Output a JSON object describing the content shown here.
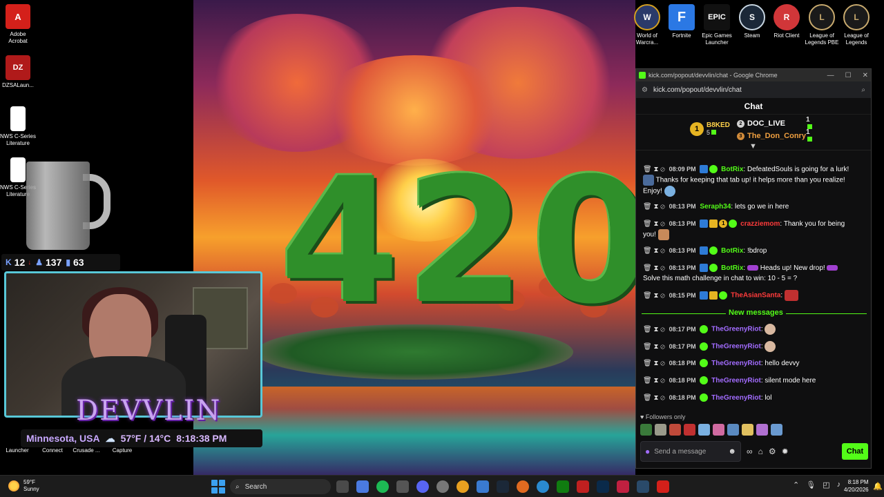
{
  "desktop_left": {
    "icons": [
      {
        "label": "Adobe Acrobat"
      },
      {
        "label": "DZSALaun..."
      },
      {
        "label": "NWS C-Series Literature"
      },
      {
        "label": "NWS C-Series Literature"
      }
    ],
    "bottom_labels": [
      "Launcher",
      "Connect",
      "Crusade ...",
      "Capture"
    ]
  },
  "desktop_right": {
    "icons": [
      {
        "label": "World of Warcra...",
        "color": "#2a3a6a",
        "glyph": "W"
      },
      {
        "label": "Fortnite",
        "color": "#2b78e4",
        "glyph": "F"
      },
      {
        "label": "Epic Games Launcher",
        "color": "#111111",
        "glyph": "EPIC"
      },
      {
        "label": "Steam",
        "color": "#1b2838",
        "glyph": "S"
      },
      {
        "label": "Riot Client",
        "color": "#d13639",
        "glyph": "R"
      },
      {
        "label": "League of Legends PBE",
        "color": "#1a1a1a",
        "glyph": "L"
      },
      {
        "label": "League of Legends",
        "color": "#1a1a1a",
        "glyph": "L"
      }
    ]
  },
  "wallpaper": {
    "text": "420"
  },
  "stream_overlay": {
    "stats": [
      {
        "icon": "kick-k-icon",
        "value": "12"
      },
      {
        "icon": "person-icon",
        "value": "137"
      },
      {
        "icon": "bars-icon",
        "value": "63"
      }
    ],
    "logo": "DEVVLIN",
    "location": "Minnesota, USA",
    "weather": "57°F / 14°C",
    "time": "8:18:38 PM"
  },
  "browser": {
    "title": "kick.com/popout/devvlin/chat - Google Chrome",
    "url": "kick.com/popout/devvlin/chat"
  },
  "chat": {
    "header": "Chat",
    "leaderboard": {
      "first": {
        "name": "B8KED",
        "count": "5"
      },
      "second": {
        "name": "DOC_LIVE",
        "count": "1"
      },
      "third": {
        "name": "The_Don_Conry",
        "count": "1"
      }
    },
    "messages": [
      {
        "time": "08:09 PM",
        "user": "BotRix",
        "text": "DefeatedSouls is going for a lurk!",
        "cont": "Thanks for keeping that tab up! it helps more than you realize! Enjoy!"
      },
      {
        "time": "08:13 PM",
        "user": "Seraph34",
        "text": "lets go we in here"
      },
      {
        "time": "08:13 PM",
        "user": "crazziemom",
        "text": "Thank you for being",
        "cont": "you!"
      },
      {
        "time": "08:13 PM",
        "user": "BotRix",
        "text": "!bdrop"
      },
      {
        "time": "08:13 PM",
        "user": "BotRix",
        "text": "Heads up! New drop!",
        "cont": "Solve this math challenge in chat to win: 10 - 5 = ?"
      },
      {
        "time": "08:15 PM",
        "user": "TheAsianSanta",
        "text": ""
      },
      {
        "time": "08:17 PM",
        "user": "TheGreenyRiot",
        "text": ""
      },
      {
        "time": "08:17 PM",
        "user": "TheGreenyRiot",
        "text": ""
      },
      {
        "time": "08:18 PM",
        "user": "TheGreenyRiot",
        "text": "hello devvy"
      },
      {
        "time": "08:18 PM",
        "user": "TheGreenyRiot",
        "text": "silent mode here"
      },
      {
        "time": "08:18 PM",
        "user": "TheGreenyRiot",
        "text": "lol"
      }
    ],
    "new_messages_label": "New messages",
    "followers_only": "Followers only",
    "input_placeholder": "Send a message",
    "send_label": "Chat"
  },
  "taskbar": {
    "weather_temp": "59°F",
    "weather_desc": "Sunny",
    "search_placeholder": "Search",
    "clock_time": "8:18 PM",
    "clock_date": "4/20/2026"
  }
}
